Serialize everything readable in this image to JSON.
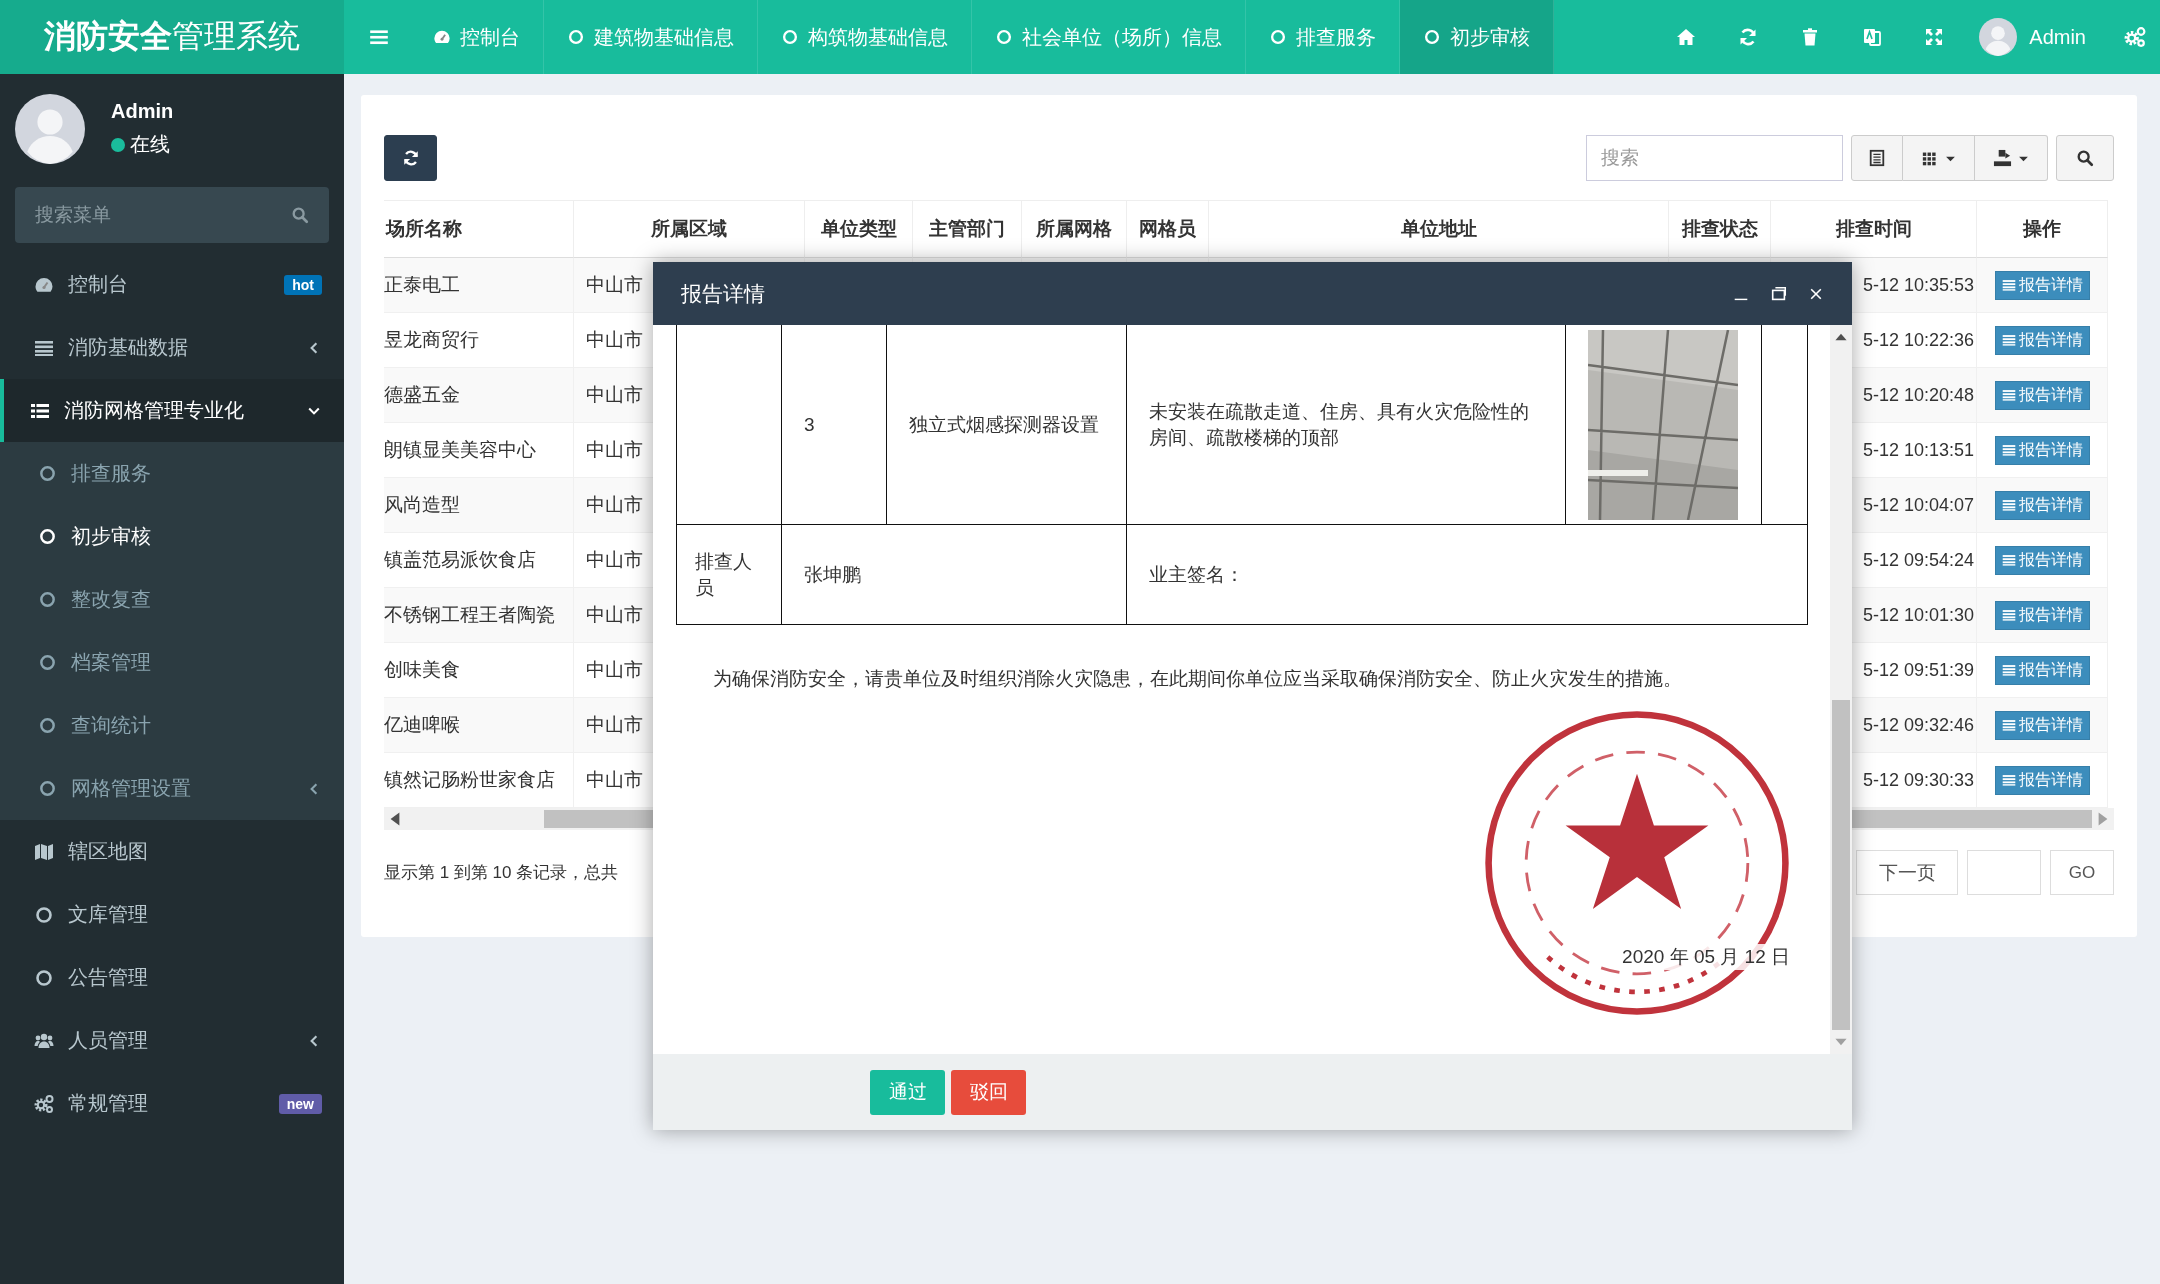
{
  "topbar": {
    "logo": "**消防安全**管理系统",
    "nav": [
      {
        "label": "控制台",
        "selected": false
      },
      {
        "label": "建筑物基础信息",
        "selected": false
      },
      {
        "label": "构筑物基础信息",
        "selected": false
      },
      {
        "label": "社会单位（场所）信息",
        "selected": false
      },
      {
        "label": "排查服务",
        "selected": false
      },
      {
        "label": "初步审核",
        "selected": true
      }
    ],
    "user": "Admin"
  },
  "sidebar": {
    "user": {
      "name": "Admin",
      "status": "在线"
    },
    "search": {
      "placeholder": "搜索菜单"
    },
    "items": [
      {
        "label": "控制台",
        "badge": {
          "text": "hot",
          "color": "#0073b7"
        }
      },
      {
        "label": "消防基础数据",
        "expanded": false
      },
      {
        "label": "消防网格管理专业化",
        "expanded": true,
        "children": [
          {
            "label": "排查服务",
            "selected": false
          },
          {
            "label": "初步审核",
            "selected": true
          },
          {
            "label": "整改复查",
            "selected": false
          },
          {
            "label": "档案管理",
            "selected": false
          },
          {
            "label": "查询统计",
            "selected": false
          },
          {
            "label": "网格管理设置",
            "selected": false,
            "expanded": false
          }
        ]
      },
      {
        "label": "辖区地图"
      },
      {
        "label": "文库管理"
      },
      {
        "label": "公告管理"
      },
      {
        "label": "人员管理",
        "expanded": false
      },
      {
        "label": "常规管理",
        "badge": {
          "text": "new",
          "color": "#605ca8"
        }
      }
    ]
  },
  "toolbar": {
    "search": {
      "placeholder": "搜索"
    }
  },
  "table": {
    "columns": [
      "场所名称",
      "所属区域",
      "单位类型",
      "主管部门",
      "所属网格",
      "网格员",
      "单位地址",
      "排查状态",
      "排查时间",
      "操作"
    ],
    "rows": [
      {
        "name": "正泰电工",
        "region": "中山市",
        "time": "5-12 10:35:53",
        "action": "报告详情"
      },
      {
        "name": "昱龙商贸行",
        "region": "中山市",
        "time": "5-12 10:22:36",
        "action": "报告详情"
      },
      {
        "name": "德盛五金",
        "region": "中山市",
        "time": "5-12 10:20:48",
        "action": "报告详情"
      },
      {
        "name": "朗镇显美美容中心",
        "region": "中山市",
        "time": "5-12 10:13:51",
        "action": "报告详情"
      },
      {
        "name": "风尚造型",
        "region": "中山市",
        "time": "5-12 10:04:07",
        "action": "报告详情"
      },
      {
        "name": "镇盖范易派饮食店",
        "region": "中山市",
        "time": "5-12 09:54:24",
        "action": "报告详情"
      },
      {
        "name": "不锈钢工程王者陶瓷",
        "region": "中山市",
        "time": "5-12 10:01:30",
        "action": "报告详情"
      },
      {
        "name": "创味美食",
        "region": "中山市",
        "time": "5-12 09:51:39",
        "action": "报告详情"
      },
      {
        "name": "亿迪啤喉",
        "region": "中山市",
        "time": "5-12 09:32:46",
        "action": "报告详情"
      },
      {
        "name": "镇然记肠粉世家食店",
        "region": "中山市",
        "time": "5-12 09:30:33",
        "action": "报告详情"
      }
    ]
  },
  "pagination": {
    "summary": "显示第 1 到第 10 条记录，总共",
    "next": "下一页",
    "go": "GO"
  },
  "modal": {
    "title": "报告详情",
    "item_row": {
      "number": "3",
      "item": "独立式烟感探测器设置",
      "issue": "未安装在疏散走道、住房、具有火灾危险性的房间、疏散楼梯的顶部"
    },
    "inspector_row": {
      "label": "排查人员",
      "name": "张坤鹏",
      "owner_signature": "业主签名："
    },
    "notice": "为确保消防安全，请贵单位及时组织消除火灾隐患，在此期间你单位应当采取确保消防安全、防止火灾发生的措施。",
    "date": "2020 年 05 月 12 日",
    "buttons": [
      {
        "label": "通过",
        "kind": "approve"
      },
      {
        "label": "驳回",
        "kind": "reject"
      }
    ]
  }
}
